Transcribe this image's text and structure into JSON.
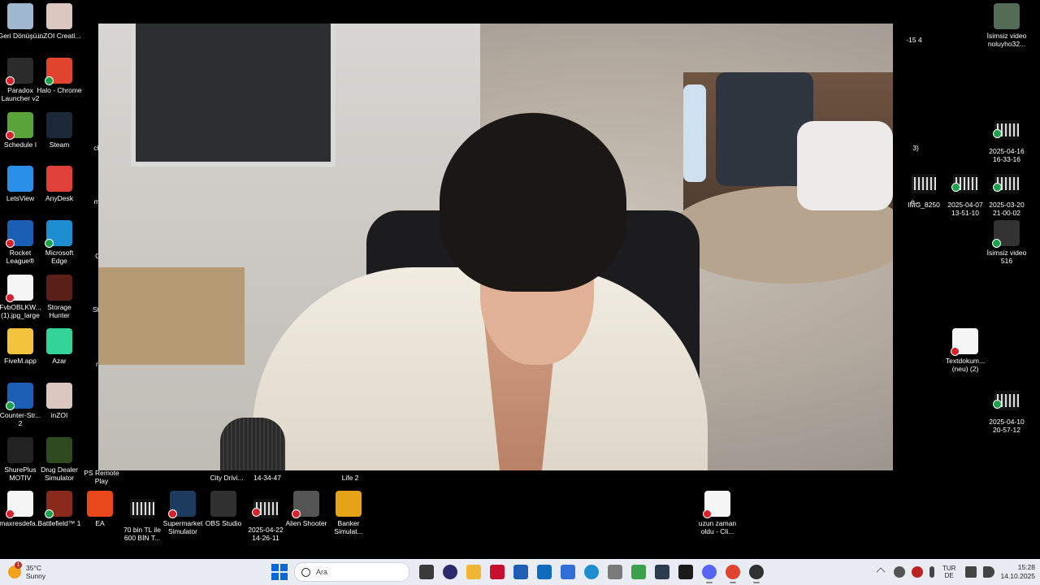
{
  "desktop": {
    "icons": [
      {
        "label": "Geri Dönüşü...",
        "color": "#9fb8d0",
        "badge": "none",
        "icon": "recycle-bin-icon"
      },
      {
        "label": "inZOI Creati...",
        "color": "#d9c7c0",
        "badge": "none",
        "icon": "inzoi-icon"
      },
      {
        "label": "Paradox Launcher v2",
        "color": "#2b2b2b",
        "badge": "x",
        "icon": "paradox-icon"
      },
      {
        "label": "Halo - Chrome",
        "color": "#e0442f",
        "badge": "ok",
        "icon": "chrome-icon"
      },
      {
        "label": "Schedule I",
        "color": "#5aa33b",
        "badge": "x",
        "icon": "schedule-icon"
      },
      {
        "label": "Steam",
        "color": "#1b2838",
        "badge": "none",
        "icon": "steam-icon"
      },
      {
        "label": "LetsView",
        "color": "#2a8fe6",
        "badge": "none",
        "icon": "letsview-icon"
      },
      {
        "label": "AnyDesk",
        "color": "#e0403a",
        "badge": "none",
        "icon": "anydesk-icon"
      },
      {
        "label": "Rocket League®",
        "color": "#1a5fb4",
        "badge": "x",
        "icon": "rocket-league-icon"
      },
      {
        "label": "Microsoft Edge",
        "color": "#1d8fd1",
        "badge": "ok",
        "icon": "edge-icon"
      },
      {
        "label": "FvbOBLKW... (1).jpg_large",
        "color": "#f5f5f5",
        "badge": "x",
        "icon": "image-file-icon"
      },
      {
        "label": "Storage Hunter",
        "color": "#5a1f18",
        "badge": "none",
        "icon": "storage-hunter-icon"
      },
      {
        "label": "FiveM.app",
        "color": "#f2c33d",
        "badge": "none",
        "icon": "folder-icon"
      },
      {
        "label": "Azar",
        "color": "#34d399",
        "badge": "none",
        "icon": "azar-icon"
      },
      {
        "label": "Counter-Str... 2",
        "color": "#1d5fb5",
        "badge": "ok",
        "icon": "counter-strike-icon"
      },
      {
        "label": "inZOI",
        "color": "#d9c7c0",
        "badge": "none",
        "icon": "inzoi-game-icon"
      },
      {
        "label": "ShurePlus MOTIV",
        "color": "#222222",
        "badge": "none",
        "icon": "shureplus-icon"
      },
      {
        "label": "Drug Dealer Simulator",
        "color": "#2e4a1f",
        "badge": "none",
        "icon": "drug-dealer-icon"
      },
      {
        "label": "maxresdefa...",
        "color": "#f5f5f5",
        "badge": "x",
        "icon": "image-file-icon"
      },
      {
        "label": "Battlefield™ 1",
        "color": "#8a2a1c",
        "badge": "ok",
        "icon": "battlefield-icon"
      },
      {
        "label": "EA",
        "color": "#e8481c",
        "badge": "none",
        "icon": "ea-icon"
      },
      {
        "label": "70 bin TL ile 600 BİN T...",
        "color": "#2a2a2a",
        "badge": "none",
        "icon": "video-file-icon"
      },
      {
        "label": "Supermarket Simulator",
        "color": "#1d3a5f",
        "badge": "x",
        "icon": "supermarket-icon"
      },
      {
        "label": "OBS Studio",
        "color": "#303030",
        "badge": "none",
        "icon": "obs-icon"
      },
      {
        "label": "2025-04-22 14-26-11",
        "color": "#2a2a2a",
        "badge": "x",
        "icon": "video-file-icon"
      },
      {
        "label": "Alien Shooter",
        "color": "#555555",
        "badge": "x",
        "icon": "alien-shooter-icon"
      },
      {
        "label": "Banker Simulat...",
        "color": "#e5a417",
        "badge": "none",
        "icon": "banker-icon"
      },
      {
        "label": "uzun zaman oldu - Cli...",
        "color": "#f5f5f5",
        "badge": "x",
        "icon": "video-clip-icon"
      },
      {
        "label": "İsimsiz video noluyho32...",
        "color": "#556b55",
        "badge": "none",
        "icon": "video-thumb-icon"
      },
      {
        "label": "2025-04-16 16-33-16",
        "color": "#2a2a2a",
        "badge": "ok",
        "icon": "video-file-icon"
      },
      {
        "label": "IMG_8250",
        "color": "#2a2a2a",
        "badge": "none",
        "icon": "video-file-icon"
      },
      {
        "label": "2025-04-07 13-51-10",
        "color": "#2a2a2a",
        "badge": "ok",
        "icon": "video-file-icon"
      },
      {
        "label": "2025-03-20 21-00-02",
        "color": "#2a2a2a",
        "badge": "ok",
        "icon": "video-file-icon"
      },
      {
        "label": "İsimsiz video 516",
        "color": "#333333",
        "badge": "ok",
        "icon": "video-thumb-icon"
      },
      {
        "label": "Textdokum... (neu) (2)",
        "color": "#f5f5f5",
        "badge": "x",
        "icon": "text-file-icon"
      },
      {
        "label": "2025-04-10 20-57-12",
        "color": "#7a1a1a",
        "badge": "ok",
        "icon": "video-file-icon"
      }
    ],
    "partial_labels": {
      "col3_a": "Go Ch",
      "col3_b": "Ch Re",
      "col3_c": "chrom",
      "col3_d": "me intro",
      "col3_e": "Ca Sim",
      "col3_f": "Sty Beya",
      "col3_g": "me intr",
      "col3_h": "n",
      "ps_remote": "PS Remote Play",
      "city_drive": "City Drivi...",
      "date_1434": "14-34-47",
      "life2": "Life 2",
      "right_15": "-15 4",
      "right_3": "3)",
      "right_e": "e..."
    }
  },
  "taskbar": {
    "weather": {
      "temp": "35°C",
      "cond": "Sunny",
      "notif": "1"
    },
    "search_placeholder": "Ara",
    "apps": [
      {
        "name": "task-view-icon",
        "color": "#3a3a3a"
      },
      {
        "name": "news24-icon",
        "color": "#2b2b6b"
      },
      {
        "name": "file-explorer-icon",
        "color": "#f2b632"
      },
      {
        "name": "mcafee-icon",
        "color": "#c8102e"
      },
      {
        "name": "pen-app-icon",
        "color": "#1e5fb5"
      },
      {
        "name": "outlook-icon",
        "color": "#0f6cbd"
      },
      {
        "name": "store-icon",
        "color": "#2f6fd6"
      },
      {
        "name": "edge-taskbar-icon",
        "color": "#1d8fd1"
      },
      {
        "name": "photos-icon",
        "color": "#7a7a7a"
      },
      {
        "name": "shield-vpn-icon",
        "color": "#3aa14a"
      },
      {
        "name": "game-app-icon",
        "color": "#2d3b4f"
      },
      {
        "name": "iv-app-icon",
        "color": "#1a1a1a"
      },
      {
        "name": "discord-icon",
        "color": "#5865f2"
      },
      {
        "name": "chrome-taskbar-icon",
        "color": "#e0442f"
      },
      {
        "name": "obs-taskbar-icon",
        "color": "#303030"
      }
    ],
    "lang": {
      "top": "TUR",
      "bottom": "DE"
    },
    "clock": {
      "time": "15:28",
      "date": "14.10.2025"
    }
  }
}
